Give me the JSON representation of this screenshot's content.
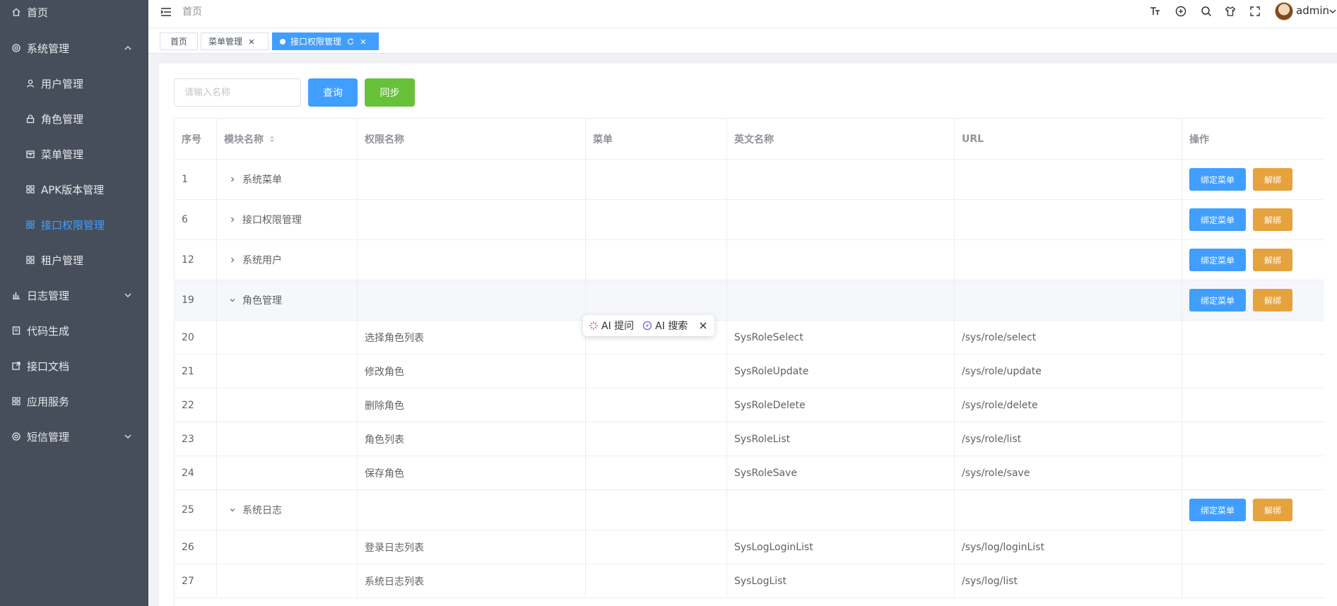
{
  "sidebar": {
    "items": [
      {
        "label": "首页",
        "icon": "home-icon"
      },
      {
        "label": "系统管理",
        "icon": "gear-icon",
        "expanded": true
      },
      {
        "label": "用户管理",
        "icon": "user-icon"
      },
      {
        "label": "角色管理",
        "icon": "lock-icon"
      },
      {
        "label": "菜单管理",
        "icon": "box-icon"
      },
      {
        "label": "APK版本管理",
        "icon": "grid-icon"
      },
      {
        "label": "接口权限管理",
        "icon": "grid-icon",
        "active": true
      },
      {
        "label": "租户管理",
        "icon": "grid-icon"
      },
      {
        "label": "日志管理",
        "icon": "chart-icon",
        "expanded": false
      },
      {
        "label": "代码生成",
        "icon": "doc-icon"
      },
      {
        "label": "接口文档",
        "icon": "external-icon"
      },
      {
        "label": "应用服务",
        "icon": "grid-icon"
      },
      {
        "label": "短信管理",
        "icon": "gear-icon",
        "expanded": false
      }
    ]
  },
  "topbar": {
    "breadcrumb": "首页",
    "user": "admin"
  },
  "tabs": [
    {
      "label": "首页"
    },
    {
      "label": "菜单管理"
    },
    {
      "label": "接口权限管理",
      "active": true
    }
  ],
  "search": {
    "placeholder": "请输入名称",
    "value": "",
    "query_label": "查询",
    "sync_label": "同步"
  },
  "table": {
    "headers": [
      "序号",
      "模块名称",
      "权限名称",
      "菜单",
      "英文名称",
      "URL",
      "操作"
    ],
    "bind_label": "绑定菜单",
    "unbind_label": "解绑",
    "rows": [
      {
        "no": "1",
        "module": "系统菜单",
        "name": "",
        "menu": "",
        "en": "",
        "url": "",
        "group": true,
        "expanded": false
      },
      {
        "no": "6",
        "module": "接口权限管理",
        "name": "",
        "menu": "",
        "en": "",
        "url": "",
        "group": true,
        "expanded": false
      },
      {
        "no": "12",
        "module": "系统用户",
        "name": "",
        "menu": "",
        "en": "",
        "url": "",
        "group": true,
        "expanded": false
      },
      {
        "no": "19",
        "module": "角色管理",
        "name": "",
        "menu": "",
        "en": "",
        "url": "",
        "group": true,
        "expanded": true,
        "highlight": true
      },
      {
        "no": "20",
        "module": "",
        "name": "选择角色列表",
        "menu": "",
        "en": "SysRoleSelect",
        "url": "/sys/role/select",
        "group": false
      },
      {
        "no": "21",
        "module": "",
        "name": "修改角色",
        "menu": "",
        "en": "SysRoleUpdate",
        "url": "/sys/role/update",
        "group": false
      },
      {
        "no": "22",
        "module": "",
        "name": "删除角色",
        "menu": "",
        "en": "SysRoleDelete",
        "url": "/sys/role/delete",
        "group": false
      },
      {
        "no": "23",
        "module": "",
        "name": "角色列表",
        "menu": "",
        "en": "SysRoleList",
        "url": "/sys/role/list",
        "group": false
      },
      {
        "no": "24",
        "module": "",
        "name": "保存角色",
        "menu": "",
        "en": "SysRoleSave",
        "url": "/sys/role/save",
        "group": false
      },
      {
        "no": "25",
        "module": "系统日志",
        "name": "",
        "menu": "",
        "en": "",
        "url": "",
        "group": true,
        "expanded": true
      },
      {
        "no": "26",
        "module": "",
        "name": "登录日志列表",
        "menu": "",
        "en": "SysLogLoginList",
        "url": "/sys/log/loginList",
        "group": false
      },
      {
        "no": "27",
        "module": "",
        "name": "系统日志列表",
        "menu": "",
        "en": "SysLogList",
        "url": "/sys/log/list",
        "group": false
      }
    ]
  },
  "ai_toolbar": {
    "ask_label": "AI 提问",
    "search_label": "AI 搜索"
  },
  "colors": {
    "sidebar_bg": "#474e5b",
    "primary": "#409eff",
    "success": "#67c23a",
    "warning": "#e6a23c"
  }
}
